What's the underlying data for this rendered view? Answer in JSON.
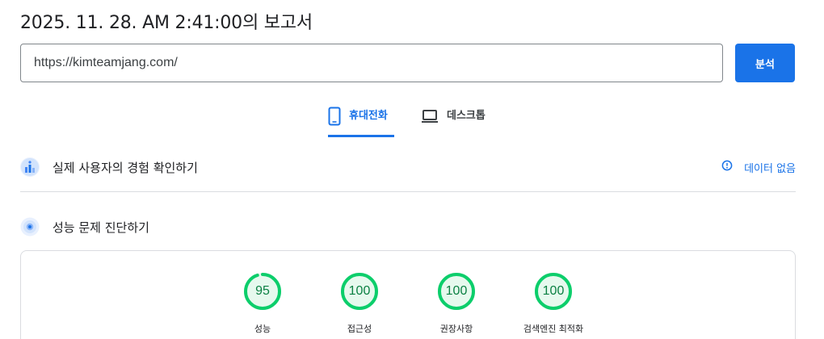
{
  "report": {
    "title": "2025. 11. 28. AM 2:41:00의 보고서"
  },
  "url_bar": {
    "value": "https://kimteamjang.com/",
    "analyze_label": "분석"
  },
  "device_tabs": [
    {
      "label": "휴대전화",
      "icon": "smartphone-icon",
      "selected": true
    },
    {
      "label": "데스크톱",
      "icon": "laptop-icon",
      "selected": false
    }
  ],
  "user_experience": {
    "title": "실제 사용자의 경험 확인하기",
    "icon": "crux-chart-icon",
    "no_data_label": "데이터 없음",
    "no_data_icon": "info-icon"
  },
  "diagnostics": {
    "title": "성능 문제 진단하기",
    "icon": "lighthouse-icon"
  },
  "scores": [
    {
      "label": "성능",
      "value": "95",
      "fraction": 0.95
    },
    {
      "label": "접근성",
      "value": "100",
      "fraction": 1.0
    },
    {
      "label": "권장사항",
      "value": "100",
      "fraction": 1.0
    },
    {
      "label": "검색엔진 최적화",
      "value": "100",
      "fraction": 1.0
    }
  ],
  "colors": {
    "accent": "#1a73e8",
    "good_score": "#0cce6b",
    "good_score_bg": "#e6f9ee",
    "good_score_text": "#0b8043"
  }
}
